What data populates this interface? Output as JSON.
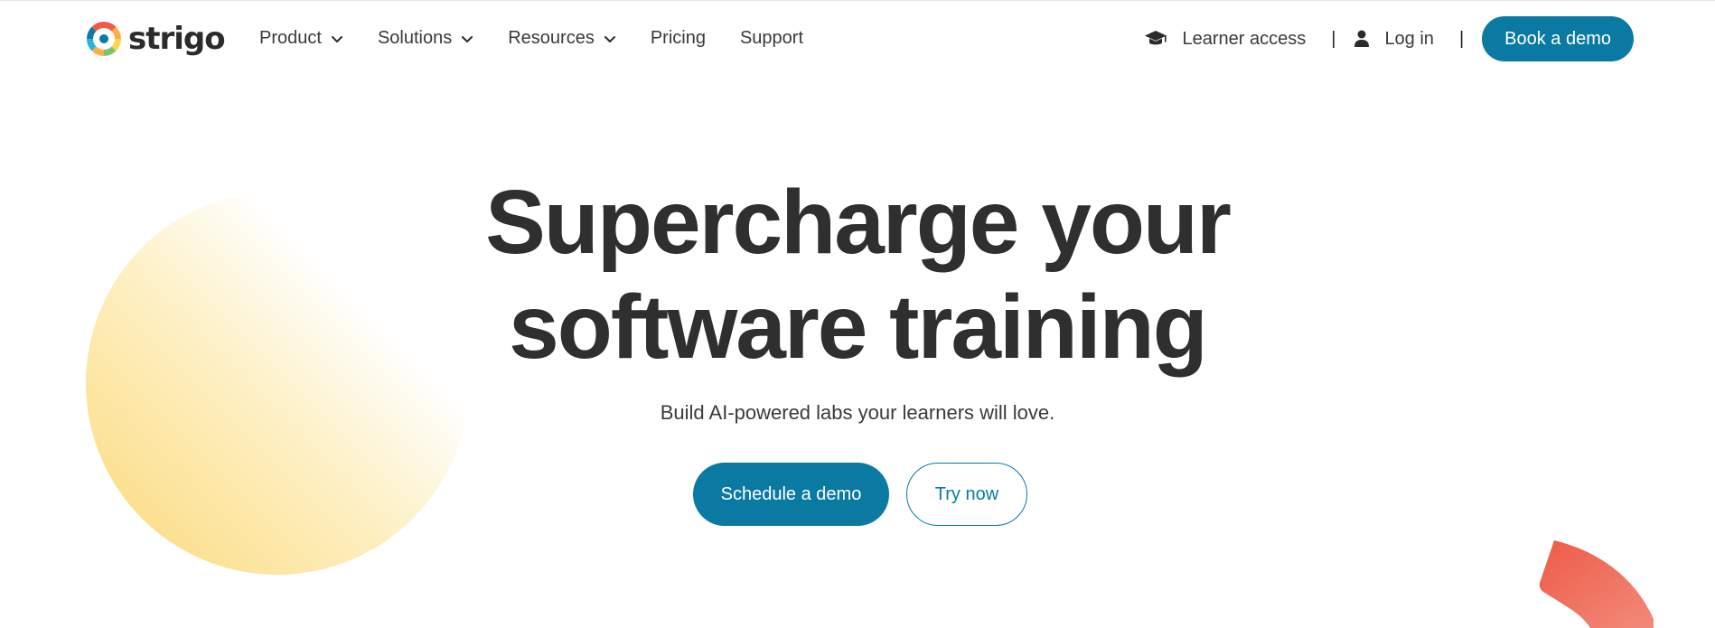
{
  "brand": {
    "name": "strigo",
    "logo_icon": "strigo-logo-icon",
    "logo_colors": [
      "#f05a4a",
      "#fbb040",
      "#ffd54f",
      "#7cc36b",
      "#2bb3d9",
      "#0a7aa3"
    ]
  },
  "nav": {
    "items": [
      {
        "label": "Product",
        "has_dropdown": true
      },
      {
        "label": "Solutions",
        "has_dropdown": true
      },
      {
        "label": "Resources",
        "has_dropdown": true
      },
      {
        "label": "Pricing",
        "has_dropdown": false
      },
      {
        "label": "Support",
        "has_dropdown": false
      }
    ],
    "learner_access": {
      "label": "Learner access",
      "icon": "graduation-cap-icon"
    },
    "separator": "|",
    "login": {
      "label": "Log in",
      "icon": "user-icon"
    },
    "book_demo": "Book a demo"
  },
  "hero": {
    "title_line1": "Supercharge your",
    "title_line2": "software training",
    "subtitle": "Build AI-powered labs your learners will love.",
    "primary_cta": "Schedule a demo",
    "secondary_cta": "Try now"
  },
  "colors": {
    "accent": "#0a7aa3",
    "text": "#2f2f2f",
    "deco_yellow": "#fcd978",
    "deco_red": "#ee5b48"
  }
}
